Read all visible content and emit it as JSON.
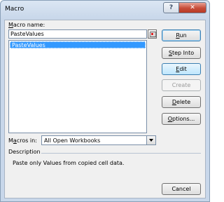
{
  "window": {
    "title": "Macro",
    "help_label": "?",
    "close_label": "✕"
  },
  "macro_name": {
    "label_pre": "",
    "label_u": "M",
    "label_post": "acro name:",
    "value": "PasteValues"
  },
  "macro_list": {
    "items": [
      "PasteValues"
    ]
  },
  "buttons": {
    "run": {
      "pre": "",
      "u": "R",
      "post": "un"
    },
    "step_into": {
      "pre": "",
      "u": "S",
      "post": "tep Into"
    },
    "edit": {
      "pre": "",
      "u": "E",
      "post": "dit"
    },
    "create": {
      "pre": "",
      "u": "",
      "post": "Create"
    },
    "delete": {
      "pre": "",
      "u": "D",
      "post": "elete"
    },
    "options": {
      "pre": "",
      "u": "O",
      "post": "ptions..."
    },
    "cancel": {
      "pre": "",
      "u": "",
      "post": "Cancel"
    }
  },
  "macros_in": {
    "label_pre": "M",
    "label_u": "a",
    "label_post": "cros in:",
    "value": "All Open Workbooks"
  },
  "description": {
    "label": "Description",
    "text": "Paste only Values from copied cell data."
  }
}
